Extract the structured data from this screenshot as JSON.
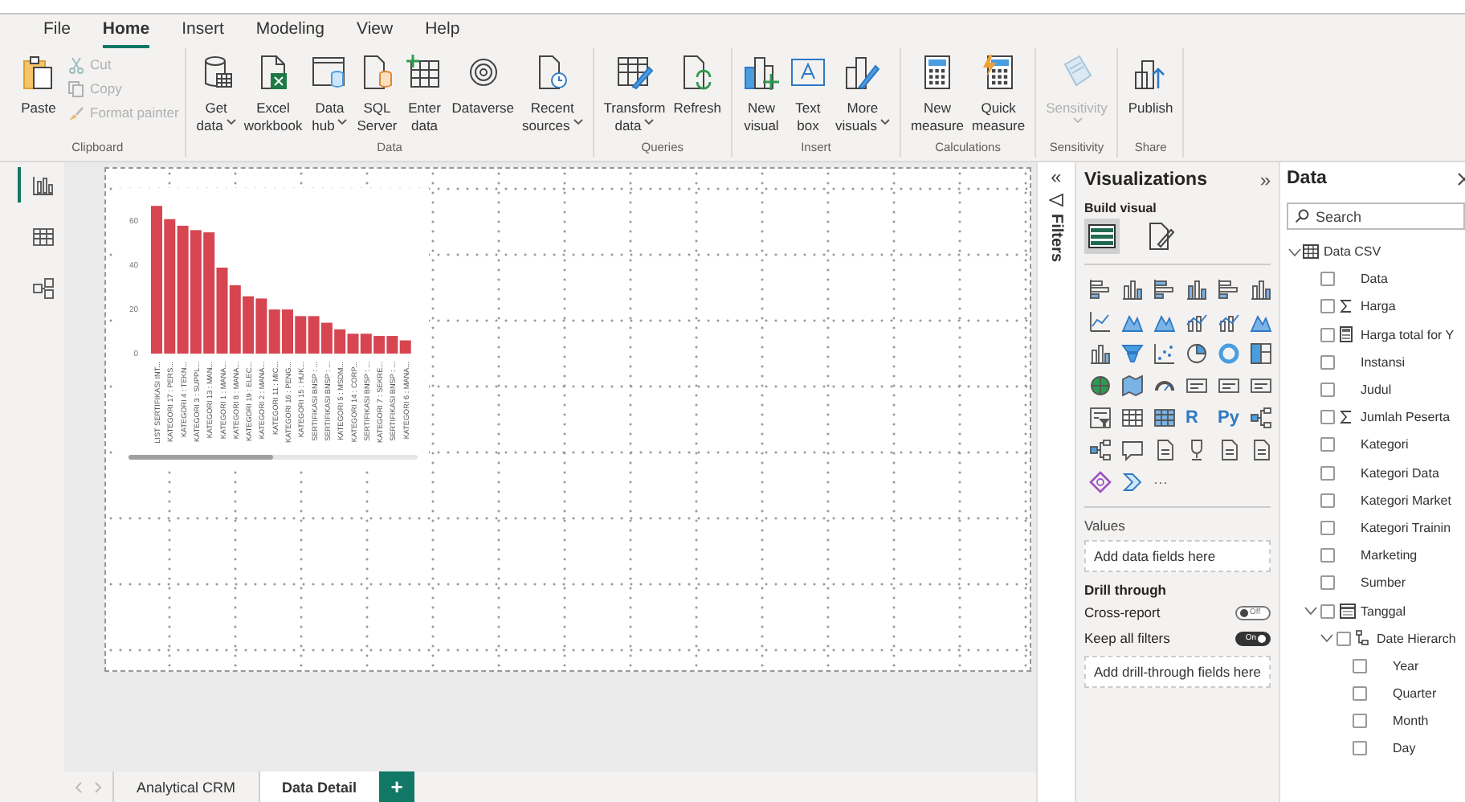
{
  "menu": [
    {
      "label": "File",
      "selected": false
    },
    {
      "label": "Home",
      "selected": true
    },
    {
      "label": "Insert",
      "selected": false
    },
    {
      "label": "Modeling",
      "selected": false
    },
    {
      "label": "View",
      "selected": false
    },
    {
      "label": "Help",
      "selected": false
    }
  ],
  "ribbon": [
    {
      "label": "Clipboard",
      "items": [
        {
          "lines": [
            "Paste"
          ],
          "kind": "large",
          "disabled": false
        },
        {
          "lines": [
            "Cut"
          ],
          "kind": "small",
          "disabled": true
        },
        {
          "lines": [
            "Copy"
          ],
          "kind": "small",
          "disabled": true
        },
        {
          "lines": [
            "Format painter"
          ],
          "kind": "small",
          "disabled": true
        }
      ]
    },
    {
      "label": "Data",
      "items": [
        {
          "lines": [
            "Get",
            "data"
          ],
          "kind": "large",
          "disabled": false,
          "dropdown": true
        },
        {
          "lines": [
            "Excel",
            "workbook"
          ],
          "kind": "large",
          "disabled": false
        },
        {
          "lines": [
            "Data",
            "hub"
          ],
          "kind": "large",
          "disabled": false,
          "dropdown": true
        },
        {
          "lines": [
            "SQL",
            "Server"
          ],
          "kind": "large",
          "disabled": false
        },
        {
          "lines": [
            "Enter",
            "data"
          ],
          "kind": "large",
          "disabled": false
        },
        {
          "lines": [
            "Dataverse"
          ],
          "kind": "large",
          "disabled": false
        },
        {
          "lines": [
            "Recent",
            "sources"
          ],
          "kind": "large",
          "disabled": false,
          "dropdown": true
        }
      ]
    },
    {
      "label": "Queries",
      "items": [
        {
          "lines": [
            "Transform",
            "data"
          ],
          "kind": "large",
          "disabled": false,
          "dropdown": true
        },
        {
          "lines": [
            "Refresh"
          ],
          "kind": "large",
          "disabled": false
        }
      ]
    },
    {
      "label": "Insert",
      "items": [
        {
          "lines": [
            "New",
            "visual"
          ],
          "kind": "large",
          "disabled": false
        },
        {
          "lines": [
            "Text",
            "box"
          ],
          "kind": "large",
          "disabled": false
        },
        {
          "lines": [
            "More",
            "visuals"
          ],
          "kind": "large",
          "disabled": false,
          "dropdown": true
        }
      ]
    },
    {
      "label": "Calculations",
      "items": [
        {
          "lines": [
            "New",
            "measure"
          ],
          "kind": "large",
          "disabled": false
        },
        {
          "lines": [
            "Quick",
            "measure"
          ],
          "kind": "large",
          "disabled": false
        }
      ]
    },
    {
      "label": "Sensitivity",
      "items": [
        {
          "lines": [
            "Sensitivity"
          ],
          "kind": "large",
          "disabled": true,
          "dropdown": true
        }
      ]
    },
    {
      "label": "Share",
      "items": [
        {
          "lines": [
            "Publish"
          ],
          "kind": "large",
          "disabled": false
        }
      ]
    }
  ],
  "views": [
    {
      "selected": true
    },
    {
      "selected": false
    },
    {
      "selected": false
    }
  ],
  "chart_data": {
    "type": "bar",
    "categories": [
      "LIST SERTIFIKASI INT...",
      "KATEGORI 17 : PERS...",
      "KATEGORI 4 : TEKN...",
      "KATEGORI 3 : SUPPL...",
      "KATEGORI 13 : MAN...",
      "KATEGORI 1 : MANA...",
      "KATEGORI 8 : MANA...",
      "KATEGORI 19 : ELEC...",
      "KATEGORI 2 : MANA...",
      "KATEGORI 11 : MIC...",
      "KATEGORI 16 : PENG...",
      "KATEGORI 15 : HUK...",
      "SERTIFIKASI BNSP : ...",
      "SERTIFIKASI BNSP : ...",
      "KATEGORI 5 : MSDM...",
      "KATEGORI 14 : CORP...",
      "SERTIFIKASI BNSP : ...",
      "KATEGORI 7 : SEKRE...",
      "SERTIFIKASI BNSP : ...",
      "KATEGORI 6 : MANA..."
    ],
    "values": [
      67,
      61,
      58,
      56,
      55,
      39,
      31,
      26,
      25,
      20,
      20,
      17,
      17,
      14,
      11,
      9,
      9,
      8,
      8,
      6
    ],
    "ylim": [
      0,
      70
    ],
    "yticks": [
      0,
      20,
      40,
      60
    ]
  },
  "page_tabs": {
    "tabs": [
      {
        "label": "Analytical CRM",
        "selected": false
      },
      {
        "label": "Data Detail",
        "selected": true
      }
    ],
    "add_label": "+"
  },
  "filters": {
    "collapse": "«",
    "label": "Filters"
  },
  "visualizations": {
    "title": "Visualizations",
    "expand": "»",
    "build_label": "Build visual",
    "modes": [
      {
        "selected": true
      },
      {
        "selected": false
      }
    ],
    "text_icons": [
      "R",
      "Py"
    ],
    "more": "···",
    "values_label": "Values",
    "values_placeholder": "Add data fields here",
    "drill_label": "Drill through",
    "toggles": [
      {
        "label": "Cross-report",
        "on": false,
        "state_label": "Off"
      },
      {
        "label": "Keep all filters",
        "on": true,
        "state_label": "On"
      }
    ],
    "drill_placeholder": "Add drill-through fields here"
  },
  "data": {
    "title": "Data",
    "search_placeholder": "Search",
    "tree": [
      {
        "label": "Data CSV",
        "kind": "table",
        "expanded": true,
        "children": [
          {
            "label": "Data",
            "checked": false
          },
          {
            "label": "Harga",
            "kind": "sum",
            "checked": false
          },
          {
            "label": "Harga total for Y",
            "kind": "measure",
            "checked": false
          },
          {
            "label": "Instansi",
            "checked": false
          },
          {
            "label": "Judul",
            "checked": false
          },
          {
            "label": "Jumlah Peserta",
            "kind": "sum",
            "checked": false
          },
          {
            "label": "Kategori",
            "checked": false
          },
          {
            "label": "Kategori Data",
            "checked": false
          },
          {
            "label": "Kategori Market",
            "checked": false
          },
          {
            "label": "Kategori Trainin",
            "checked": false
          },
          {
            "label": "Marketing",
            "checked": false
          },
          {
            "label": "Sumber",
            "checked": false
          },
          {
            "label": "Tanggal",
            "kind": "date",
            "checked": false,
            "expanded": true,
            "children": [
              {
                "label": "Date Hierarch",
                "kind": "hierarchy",
                "checked": false,
                "expanded": true,
                "children": [
                  {
                    "label": "Year",
                    "checked": false
                  },
                  {
                    "label": "Quarter",
                    "checked": false
                  },
                  {
                    "label": "Month",
                    "checked": false
                  },
                  {
                    "label": "Day",
                    "checked": false
                  }
                ]
              }
            ]
          }
        ]
      }
    ]
  }
}
